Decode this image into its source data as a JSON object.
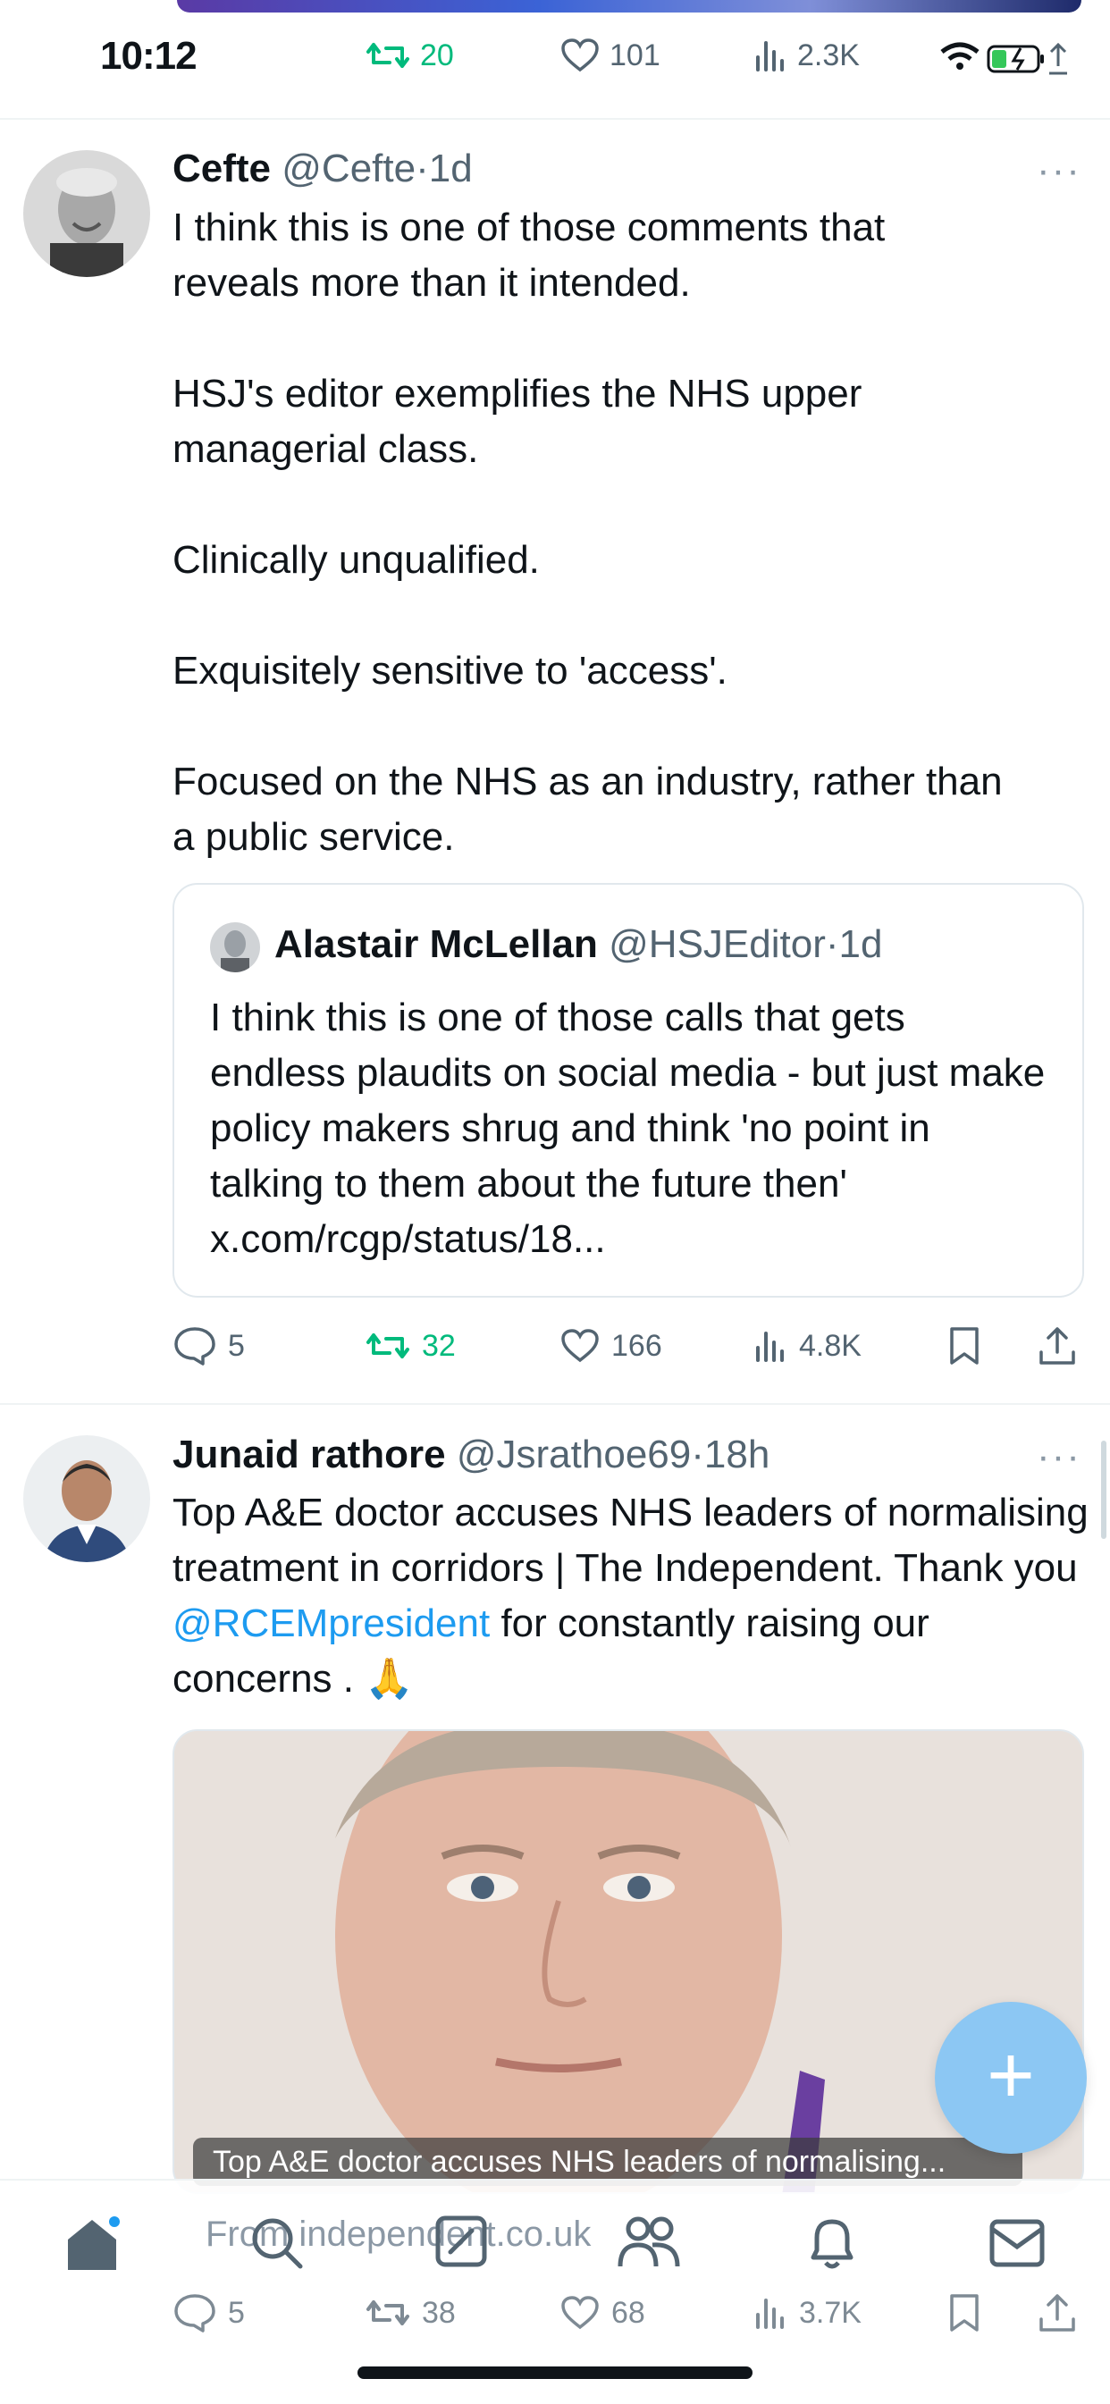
{
  "status_bar": {
    "time": "10:12"
  },
  "top_actions": {
    "retweets": "20",
    "likes": "101",
    "views": "2.3K"
  },
  "tweet1": {
    "name": "Cefte",
    "handle": "@Cefte",
    "sep": "·",
    "age": "1d",
    "more": "···",
    "text": "I think this is one of those comments that\nreveals more than it intended.\n\nHSJ's editor exemplifies the NHS upper\nmanagerial class.\n\nClinically unqualified.\n\nExquisitely sensitive to 'access'.\n\nFocused on the NHS as an industry, rather than\na public service.",
    "quote": {
      "name": "Alastair McLellan",
      "handle": "@HSJEditor",
      "sep": "·",
      "age": "1d",
      "text": "I think this is one of those calls that gets endless plaudits on social media - but just make policy makers shrug and think 'no point in talking to them about the future then' x.com/rcgp/status/18..."
    },
    "stats": {
      "replies": "5",
      "retweets": "32",
      "likes": "166",
      "views": "4.8K"
    }
  },
  "tweet2": {
    "name": "Junaid rathore",
    "handle": "@Jsrathoe69",
    "sep": "·",
    "age": "18h",
    "more": "···",
    "text_part1": "Top A&E doctor accuses NHS leaders of normalising treatment in corridors | The Independent. Thank you ",
    "mention": "@RCEMpresident",
    "text_part2": " for constantly raising our concerns . ",
    "emoji": "🙏",
    "media_caption": "Top A&E doctor accuses NHS leaders of normalising...",
    "source": "From independent.co.uk",
    "stats": {
      "replies": "5",
      "retweets": "38",
      "likes": "68",
      "views": "3.7K"
    }
  },
  "colors": {
    "accent": "#1d9bf0",
    "retweet_green": "#00ba7c",
    "secondary": "#536471"
  },
  "tab_bar": [
    "home-icon",
    "search-icon",
    "grok-icon",
    "communities-icon",
    "notifications-icon",
    "messages-icon"
  ]
}
